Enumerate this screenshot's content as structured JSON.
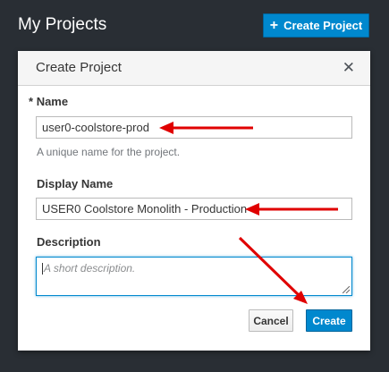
{
  "header": {
    "title": "My Projects",
    "create_button_label": "Create Project"
  },
  "modal": {
    "title": "Create Project",
    "name": {
      "label": "Name",
      "required_marker": "*",
      "value": "user0-coolstore-prod",
      "help": "A unique name for the project."
    },
    "display_name": {
      "label": "Display Name",
      "value": "USER0 Coolstore Monolith - Production"
    },
    "description": {
      "label": "Description",
      "placeholder": "A short description."
    },
    "cancel_label": "Cancel",
    "create_label": "Create"
  },
  "colors": {
    "background": "#292e34",
    "primary": "#0088ce",
    "annotation_arrow": "#e00000"
  },
  "icons": {
    "plus": "plus-icon",
    "close": "close-icon",
    "resize": "resize-handle-icon"
  }
}
